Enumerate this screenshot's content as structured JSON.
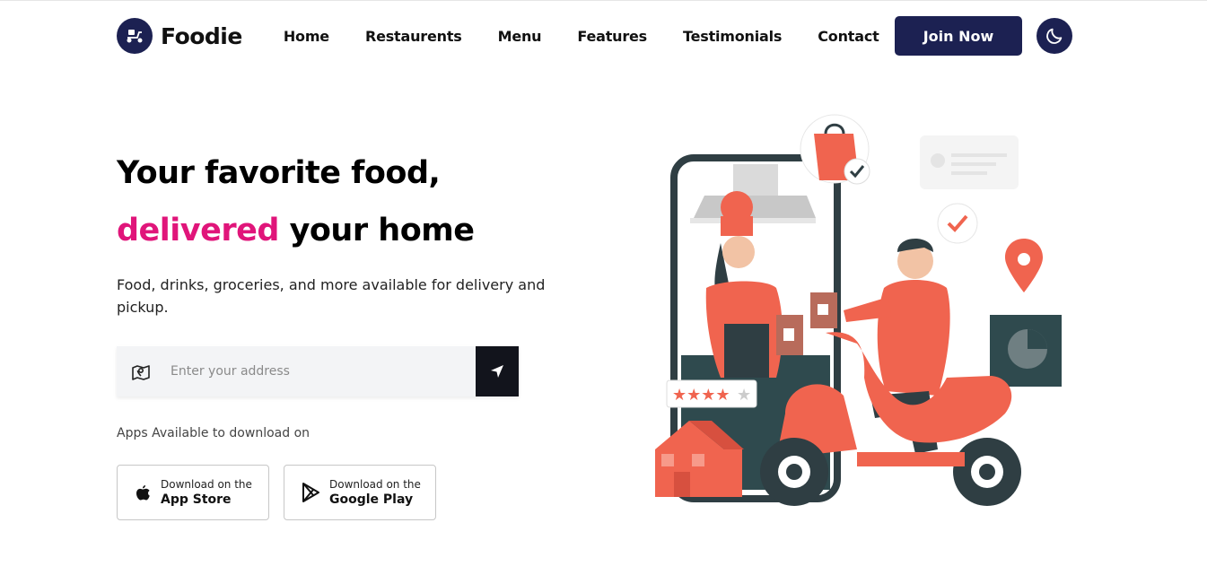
{
  "brand": {
    "name": "Foodie",
    "logo_icon": "scooter-icon"
  },
  "nav": {
    "items": [
      {
        "label": "Home"
      },
      {
        "label": "Restaurents"
      },
      {
        "label": "Menu"
      },
      {
        "label": "Features"
      },
      {
        "label": "Testimonials"
      },
      {
        "label": "Contact"
      }
    ],
    "join_label": "Join Now",
    "theme_icon": "moon-icon"
  },
  "hero": {
    "title_line1": "Your favorite food,",
    "title_highlight": "delivered",
    "title_rest": " your home",
    "subtitle": "Food, drinks, groceries, and more available for delivery and pickup."
  },
  "search": {
    "placeholder": "Enter your address",
    "value": "",
    "left_icon": "map-pin-icon",
    "submit_icon": "navigation-arrow-icon"
  },
  "apps": {
    "label": "Apps Available to download on",
    "stores": [
      {
        "small": "Download on the",
        "big": "App Store",
        "icon": "apple-icon"
      },
      {
        "small": "Download on the",
        "big": "Google Play",
        "icon": "play-icon"
      }
    ]
  },
  "colors": {
    "brand_navy": "#1c2152",
    "accent_pink": "#e0157a",
    "illustration_coral": "#f0644f"
  }
}
